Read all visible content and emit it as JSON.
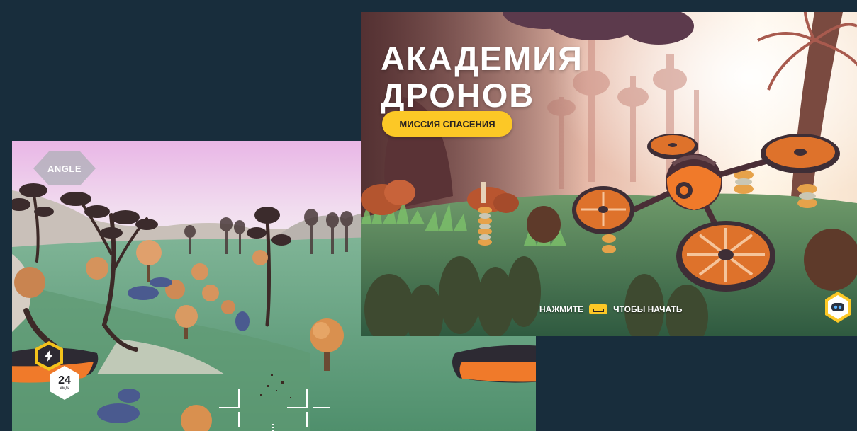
{
  "gameplay": {
    "camera_badge": "ANGLE",
    "boost_icon": "lightning-icon",
    "speed": {
      "value": "24",
      "unit": "км/ч"
    }
  },
  "title_screen": {
    "title_line1": "АКАДЕМИЯ",
    "title_line2": "ДРОНОВ",
    "subtitle": "МИССИЯ СПАСЕНИЯ",
    "prompt_before": "НАЖМИТЕ",
    "prompt_key_icon": "spacebar-icon",
    "prompt_after": "ЧТОБЫ НАЧАТЬ",
    "corner_icon": "robot-face-icon"
  },
  "colors": {
    "background": "#182d3c",
    "accent_yellow": "#fcc826",
    "drone_orange": "#f07a2a",
    "hud_dark": "#2d2a33"
  }
}
